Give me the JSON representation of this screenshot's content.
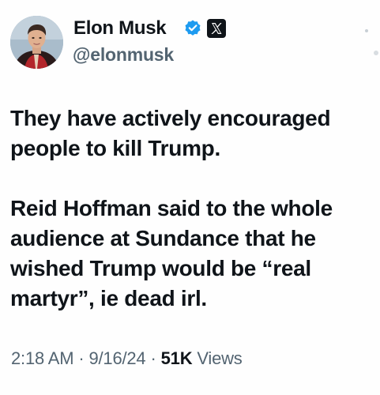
{
  "author": {
    "display_name": "Elon Musk",
    "handle": "@elonmusk",
    "verified_icon": "verified-badge-icon",
    "affiliation_icon": "x-logo-icon",
    "verified_color": "#1d9bf0"
  },
  "tweet": {
    "paragraphs": [
      "They have actively encouraged people to kill Trump.",
      "Reid Hoffman said to the whole audience at Sundance that he wished Trump would be “real martyr”, ie dead irl."
    ]
  },
  "meta": {
    "time": "2:18 AM",
    "separator": "·",
    "date": "9/16/24",
    "views_count": "51K",
    "views_label": "Views"
  },
  "icons": {
    "more": "more-options-icon"
  }
}
